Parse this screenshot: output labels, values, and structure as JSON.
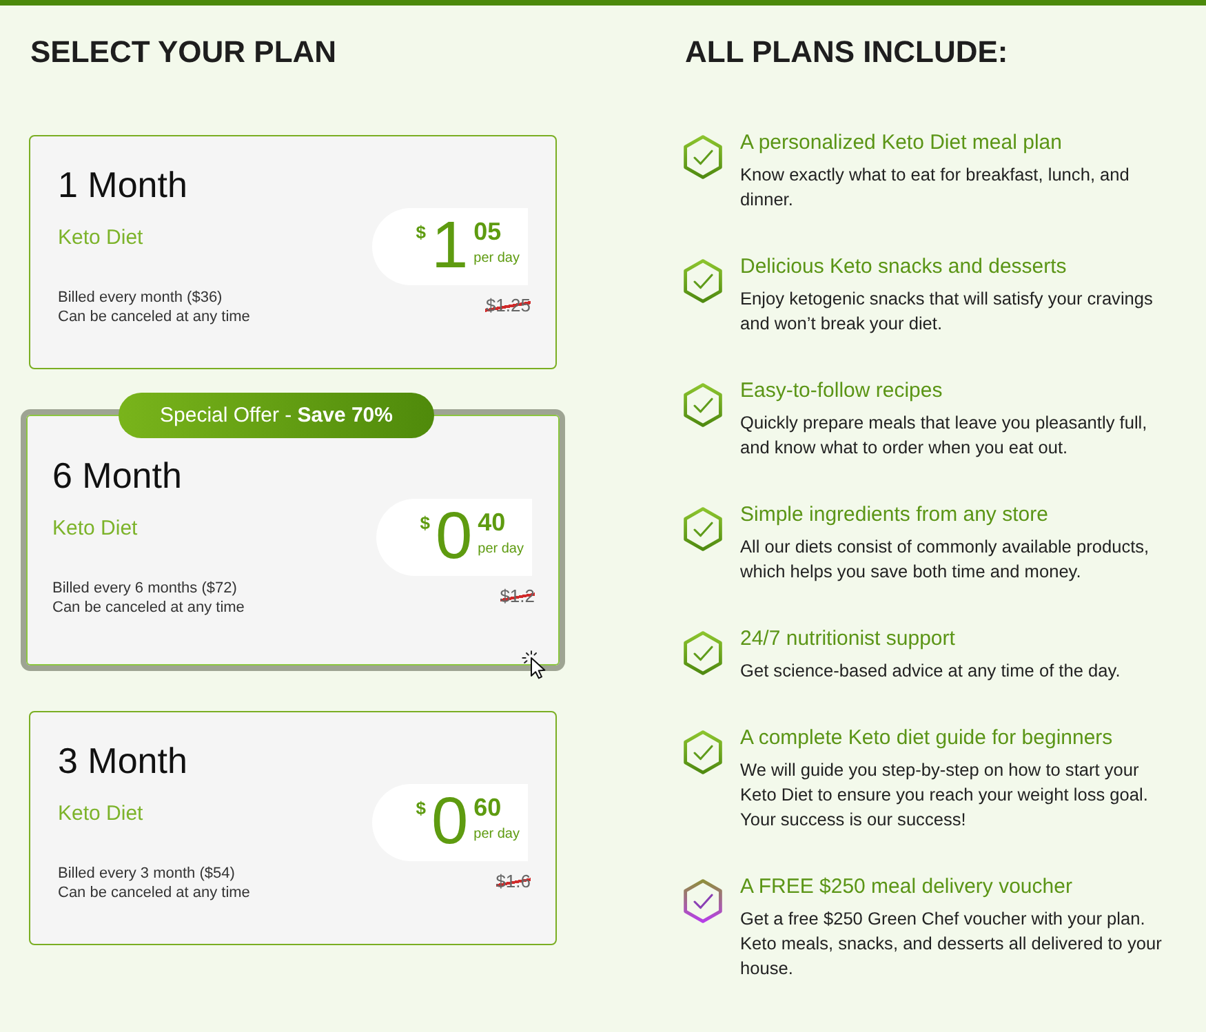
{
  "plan_section": {
    "title": "SELECT YOUR PLAN",
    "plans": [
      {
        "duration": "1 Month",
        "diet": "Keto Diet",
        "currency": "$",
        "whole": "1",
        "cents": "05",
        "unit": "per day",
        "billing": "Billed every month ($36)",
        "cancellation": "Can be canceled at any time",
        "old_price": "$1.25",
        "selected": false
      },
      {
        "badge": "Special Offer - **Save 70%**",
        "duration": "6 Month",
        "diet": "Keto Diet",
        "currency": "$",
        "whole": "0",
        "cents": "40",
        "unit": "per day",
        "billing": "Billed every 6 months ($72)",
        "cancellation": "Can be canceled at any time",
        "old_price": "$1.2",
        "selected": true
      },
      {
        "duration": "3 Month",
        "diet": "Keto Diet",
        "currency": "$",
        "whole": "0",
        "cents": "60",
        "unit": "per day",
        "billing": "Billed every 3 month ($54)",
        "cancellation": "Can be canceled at any time",
        "old_price": "$1.6",
        "selected": false
      }
    ]
  },
  "includes_section": {
    "title": "ALL PLANS INCLUDE:",
    "features": [
      {
        "kind": "included",
        "heading": "A personalized Keto Diet meal plan",
        "description": "Know exactly what to eat for breakfast, lunch, and dinner."
      },
      {
        "kind": "included",
        "heading": "Delicious Keto snacks and desserts",
        "description": "Enjoy ketogenic snacks that will satisfy your cravings and won’t break your diet."
      },
      {
        "kind": "included",
        "heading": "Easy-to-follow recipes",
        "description": "Quickly prepare meals that leave you pleasantly full, and know what to order when you eat out."
      },
      {
        "kind": "included",
        "heading": "Simple ingredients from any store",
        "description": "All our diets consist of commonly available products, which helps you save both time and money."
      },
      {
        "kind": "included",
        "heading": "24/7 nutritionist support",
        "description": "Get science-based advice at any time of the day."
      },
      {
        "kind": "included",
        "heading": "A complete Keto diet guide for beginners",
        "description": "We will guide you step-by-step on how to start your Keto Diet to ensure you reach your weight loss goal. Your success is our success!"
      },
      {
        "kind": "bonus",
        "heading": "A FREE $250 meal delivery voucher",
        "description": "Get a free $250 Green Chef voucher with your plan. Keto meals, snacks, and desserts all delivered to your house."
      }
    ]
  }
}
